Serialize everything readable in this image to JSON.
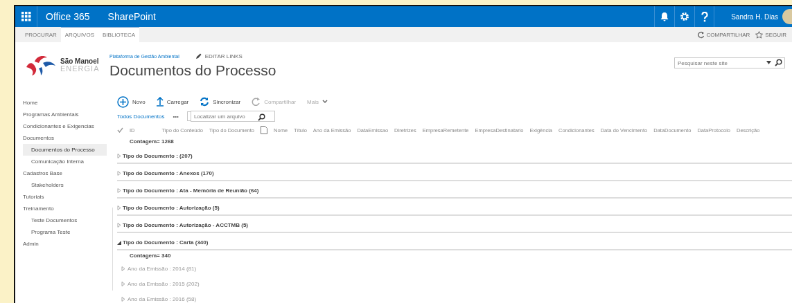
{
  "suite_bar": {
    "app_name": "Office 365",
    "product": "SharePoint",
    "user": "Sandra H. Dias"
  },
  "ribbon": {
    "tabs": [
      {
        "label": "PROCURAR",
        "selected": false
      },
      {
        "label": "ARQUIVOS",
        "selected": false
      },
      {
        "label": "BIBLIOTECA",
        "selected": false
      }
    ],
    "actions": [
      "COMPARTILHAR",
      "SEGUIR"
    ]
  },
  "logo": {
    "name": "São Manoel",
    "tagline": "ENERGIA"
  },
  "site": {
    "breadcrumb": "Plataforma de Gestão Ambiental",
    "edit_links": "EDITAR LINKS",
    "title": "Documentos do Processo",
    "search_placeholder": "Pesquisar neste site"
  },
  "sidebar": {
    "items": [
      {
        "label": "Home",
        "selected": false
      },
      {
        "label": "Programas Ambientais",
        "selected": false
      },
      {
        "label": "Condicionantes e Exigencias",
        "selected": false
      },
      {
        "label": "Documentos",
        "selected": false,
        "children": [
          {
            "label": "Documentos do Processo",
            "selected": true
          },
          {
            "label": "Comunicação Interna",
            "selected": false
          }
        ]
      },
      {
        "label": "Cadastros Base",
        "selected": false,
        "children": [
          {
            "label": "Stakeholders",
            "selected": false
          }
        ]
      },
      {
        "label": "Tutoriais",
        "selected": false
      },
      {
        "label": "Treinamento",
        "selected": false,
        "children": [
          {
            "label": "Teste Documentos",
            "selected": false
          },
          {
            "label": "Programa Teste",
            "selected": false
          }
        ]
      },
      {
        "label": "Admin",
        "selected": false
      }
    ]
  },
  "toolbar": [
    {
      "kind": "new",
      "label": "Novo",
      "disabled": false
    },
    {
      "kind": "upload",
      "label": "Carregar",
      "disabled": false
    },
    {
      "kind": "sync",
      "label": "Sincronizar",
      "disabled": false
    },
    {
      "kind": "share",
      "label": "Compartilhar",
      "disabled": true
    },
    {
      "kind": "more",
      "label": "Mais",
      "disabled": true
    }
  ],
  "view": {
    "name": "Todos Documentos",
    "ellipsis": "•••",
    "find_placeholder": "Localizar um arquivo"
  },
  "table": {
    "columns": [
      "ID",
      "Tipo do Conteúdo",
      "Tipo do Documento",
      "Nome",
      "Título",
      "Ano da Emissão",
      "DataEmissao",
      "Diretrizes",
      "EmpresaRemetente",
      "EmpresaDestinatario",
      "Exigência",
      "Condicionantes",
      "Data do Vencimento",
      "DataDocumento",
      "DataProtocolo",
      "Descrição"
    ],
    "total": "Contagem= 1268",
    "groups": [
      {
        "label": "Tipo do Documento : (207)",
        "expanded": false
      },
      {
        "label": "Tipo do Documento : Anexos (170)",
        "expanded": false
      },
      {
        "label": "Tipo do Documento : Ata - Memória de Reunião (64)",
        "expanded": false
      },
      {
        "label": "Tipo do Documento : Autorização (5)",
        "expanded": false
      },
      {
        "label": "Tipo do Documento : Autorização - ACCTMB (5)",
        "expanded": false
      },
      {
        "label": "Tipo do Documento : Carta (340)",
        "expanded": true,
        "count": "Contagem= 340",
        "children": [
          {
            "label": "Ano da Emissão : 2014 (81)",
            "expanded": false
          },
          {
            "label": "Ano da Emissão : 2015 (202)",
            "expanded": false
          },
          {
            "label": "Ano da Emissão : 2016 (58)",
            "expanded": false
          }
        ]
      }
    ]
  }
}
